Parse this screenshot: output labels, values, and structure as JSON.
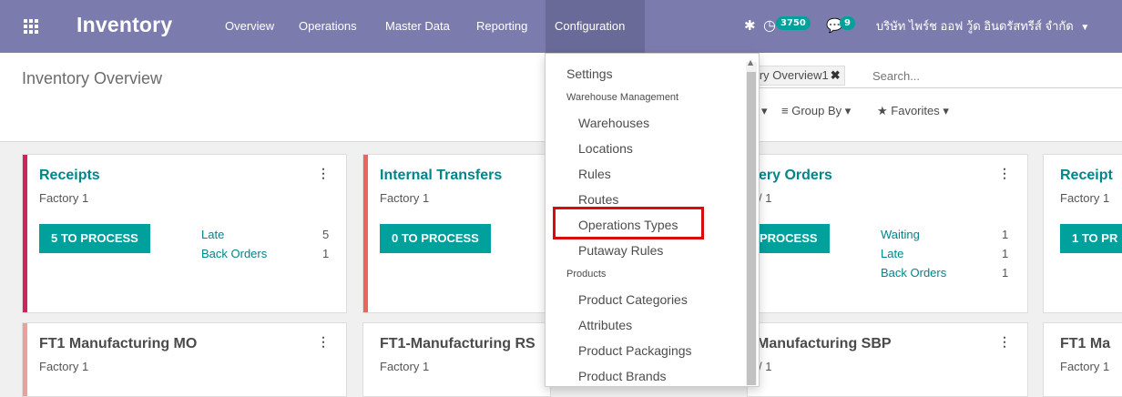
{
  "navbar": {
    "app_title": "Inventory",
    "menus": [
      "Overview",
      "Operations",
      "Master Data",
      "Reporting",
      "Configuration"
    ],
    "activity_count": "3750",
    "messages_count": "9",
    "company": "บริษัท ไพร์ช ออฟ วู้ด อินดรัสทรีส์ จำกัด"
  },
  "control_panel": {
    "breadcrumb": "Inventory Overview",
    "facet": "tory Overview1",
    "search_placeholder": "Search...",
    "group_by": "Group By",
    "favorites": "Favorites"
  },
  "cards": [
    {
      "title": "Receipts",
      "sub": "Factory 1",
      "button": "5 TO PROCESS",
      "stats": [
        {
          "label": "Late",
          "value": "5"
        },
        {
          "label": "Back Orders",
          "value": "1"
        }
      ],
      "color": "#d0245f"
    },
    {
      "title": "Internal Transfers",
      "sub": "Factory 1",
      "button": "0 TO PROCESS",
      "stats": [],
      "color": "#e8675a"
    },
    {
      "title": "ery Orders",
      "sub": "/ 1",
      "button": "PROCESS",
      "stats": [
        {
          "label": "Waiting",
          "value": "1"
        },
        {
          "label": "Late",
          "value": "1"
        },
        {
          "label": "Back Orders",
          "value": "1"
        }
      ]
    },
    {
      "title": "Receipt",
      "sub": "Factory 1",
      "button": "1 TO PR"
    },
    {
      "title": "FT1 Manufacturing MO",
      "sub": "Factory 1",
      "color": "#e8a0a0"
    },
    {
      "title": "FT1-Manufacturing RS",
      "sub": "Factory 1"
    },
    {
      "title": "Manufacturing SBP",
      "sub": "/ 1"
    },
    {
      "title": "FT1 Ma",
      "sub": "Factory 1"
    }
  ],
  "dropdown": {
    "items": [
      "Settings",
      "Warehouse Management",
      "Warehouses",
      "Locations",
      "Rules",
      "Routes",
      "Operations Types",
      "Putaway Rules",
      "Products",
      "Product Categories",
      "Attributes",
      "Product Packagings",
      "Product Brands"
    ]
  },
  "colors": {
    "navbar": "#7c7bad",
    "accent": "#00a09d",
    "highlight": "#d60d0d"
  }
}
